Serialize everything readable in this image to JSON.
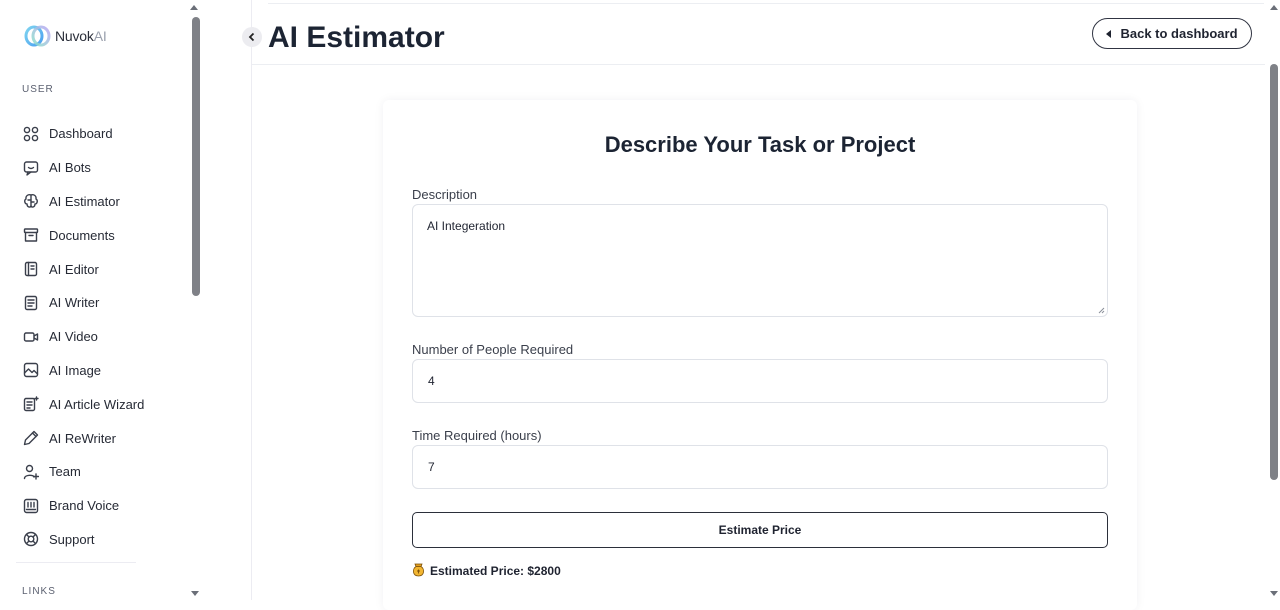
{
  "brand": {
    "name": "Nuvok",
    "suffix": "AI"
  },
  "sidebar": {
    "user_label": "USER",
    "links_label": "LINKS",
    "items": [
      {
        "label": "Dashboard",
        "icon": "grid-icon"
      },
      {
        "label": "AI Bots",
        "icon": "chat-bot-icon"
      },
      {
        "label": "AI Estimator",
        "icon": "brain-icon"
      },
      {
        "label": "Documents",
        "icon": "archive-icon"
      },
      {
        "label": "AI Editor",
        "icon": "editor-icon"
      },
      {
        "label": "AI Writer",
        "icon": "file-text-icon"
      },
      {
        "label": "AI Video",
        "icon": "video-icon"
      },
      {
        "label": "AI Image",
        "icon": "image-icon"
      },
      {
        "label": "AI Article Wizard",
        "icon": "article-wizard-icon"
      },
      {
        "label": "AI ReWriter",
        "icon": "pen-icon"
      },
      {
        "label": "Team",
        "icon": "user-plus-icon"
      },
      {
        "label": "Brand Voice",
        "icon": "brand-voice-icon"
      },
      {
        "label": "Support",
        "icon": "lifebuoy-icon"
      }
    ]
  },
  "header": {
    "title": "AI Estimator",
    "back_label": "Back to dashboard"
  },
  "form": {
    "title": "Describe Your Task or Project",
    "description_label": "Description",
    "description_value": "AI Integeration",
    "people_label": "Number of People Required",
    "people_value": "4",
    "time_label": "Time Required (hours)",
    "time_value": "7",
    "submit_label": "Estimate Price",
    "result_icon": "money-bag-icon",
    "result_text": "Estimated Price: $2800"
  },
  "colors": {
    "text": "#1c2433",
    "border": "#dfe2e8",
    "sidebar_border": "#ececf2"
  }
}
